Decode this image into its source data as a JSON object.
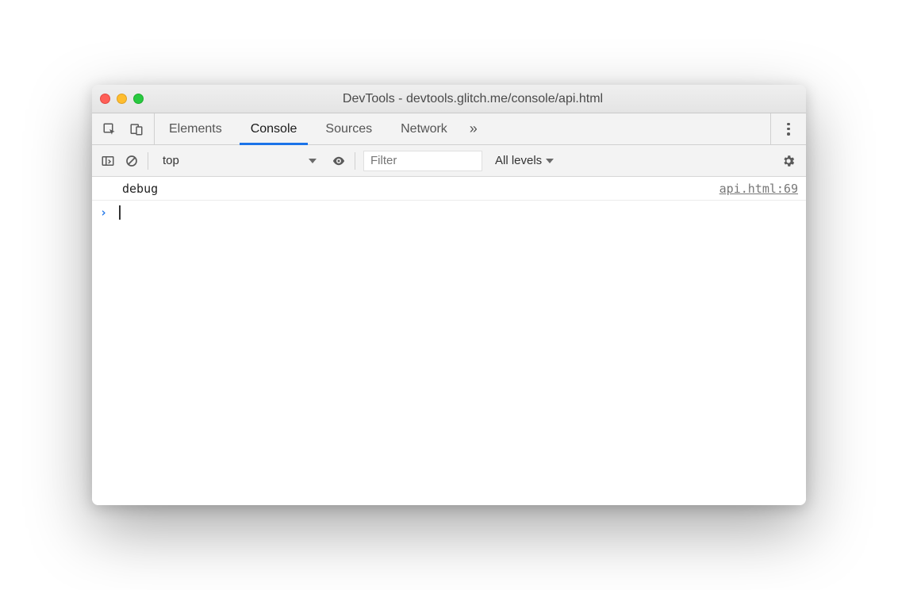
{
  "window": {
    "title": "DevTools - devtools.glitch.me/console/api.html"
  },
  "tabs": {
    "items": [
      {
        "label": "Elements",
        "active": false
      },
      {
        "label": "Console",
        "active": true
      },
      {
        "label": "Sources",
        "active": false
      },
      {
        "label": "Network",
        "active": false
      }
    ],
    "overflow_glyph": "»"
  },
  "consoleToolbar": {
    "context": "top",
    "filter_placeholder": "Filter",
    "levels_label": "All levels"
  },
  "consoleLogs": [
    {
      "message": "debug",
      "source": "api.html:69"
    }
  ],
  "prompt": {
    "glyph": "›"
  }
}
